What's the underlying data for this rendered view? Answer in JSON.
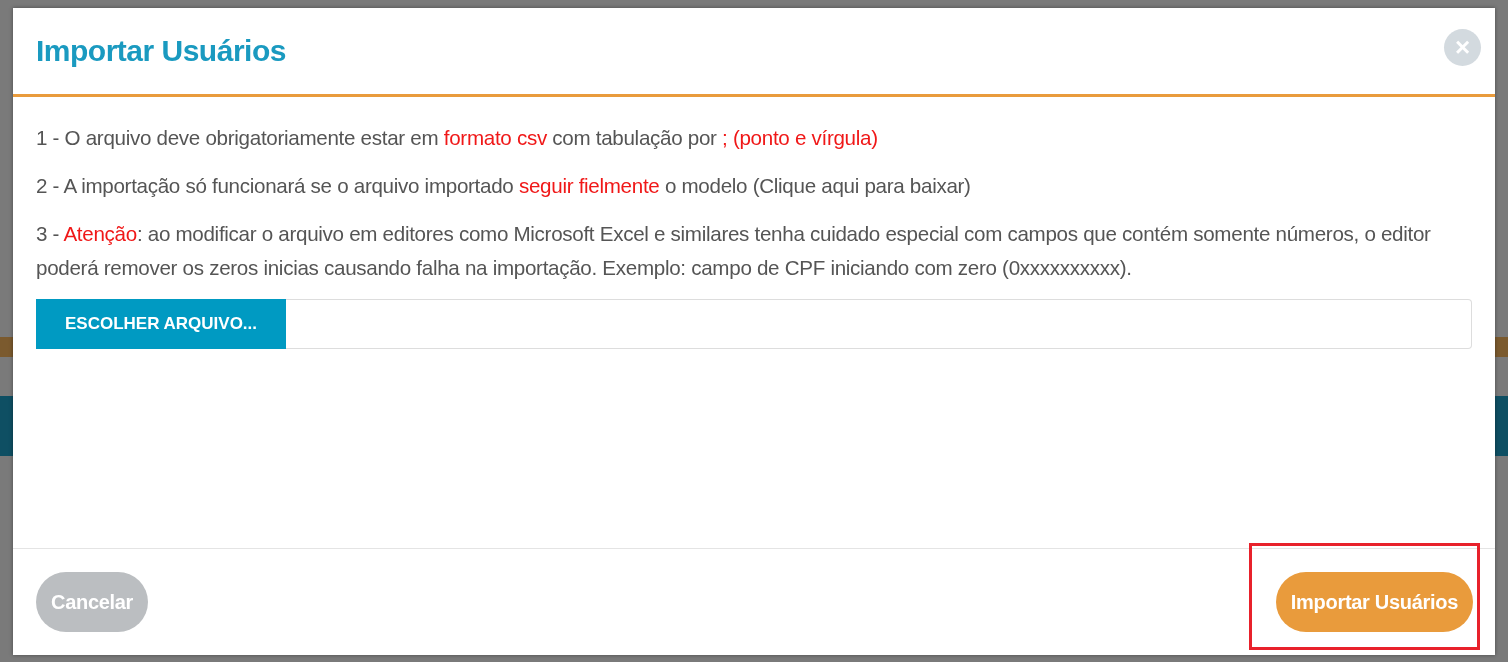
{
  "dialog": {
    "title": "Importar Usuários",
    "close_label": "×",
    "instructions": [
      {
        "segments": [
          {
            "text": "1 - O arquivo deve obrigatoriamente estar em ",
            "highlight": false
          },
          {
            "text": "formato csv",
            "highlight": true
          },
          {
            "text": " com tabulação por ",
            "highlight": false
          },
          {
            "text": "; (ponto e vírgula)",
            "highlight": true
          }
        ]
      },
      {
        "segments": [
          {
            "text": "2 - A importação só funcionará se o arquivo importado ",
            "highlight": false
          },
          {
            "text": "seguir fielmente",
            "highlight": true
          },
          {
            "text": " o modelo (Clique aqui para baixar)",
            "highlight": false
          }
        ]
      },
      {
        "segments": [
          {
            "text": "3 - ",
            "highlight": false
          },
          {
            "text": "Atenção",
            "highlight": true
          },
          {
            "text": ": ao modificar o arquivo em editores como Microsoft Excel e similares tenha cuidado especial com campos que contém somente números, o editor poderá remover os zeros inicias causando falha na importação. Exemplo: campo de CPF iniciando com zero (0xxxxxxxxxx).",
            "highlight": false
          }
        ]
      }
    ],
    "file_button": "ESCOLHER ARQUIVO...",
    "buttons": [
      {
        "label": "Cancelar",
        "kind": "secondary",
        "highlighted": false
      },
      {
        "label": "Importar Usuários",
        "kind": "primary",
        "highlighted": true
      }
    ]
  }
}
